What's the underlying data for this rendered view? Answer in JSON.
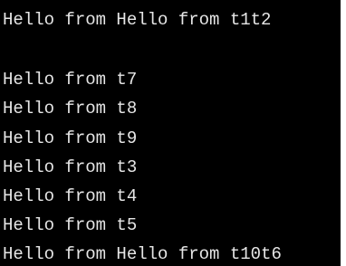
{
  "terminal": {
    "lines": [
      "Hello from Hello from t1t2",
      "",
      "Hello from t7",
      "Hello from t8",
      "Hello from t9",
      "Hello from t3",
      "Hello from t4",
      "Hello from t5",
      "Hello from Hello from t10t6"
    ],
    "background": "#000000",
    "text_color": "#e6e6e6"
  }
}
